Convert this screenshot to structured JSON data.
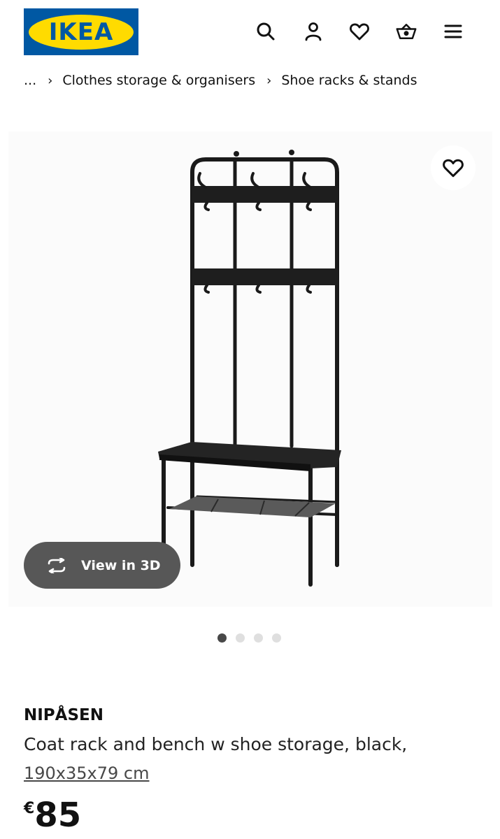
{
  "header": {
    "logo_text": "IKEA",
    "icons": [
      "search-icon",
      "user-icon",
      "heart-icon",
      "basket-icon",
      "menu-icon"
    ]
  },
  "breadcrumb": {
    "items": [
      "...",
      "Clothes storage & organisers",
      "Shoe racks & stands"
    ],
    "separator": "›"
  },
  "gallery": {
    "view3d_label": "View in 3D",
    "dots_total": 4,
    "dots_active": 1
  },
  "product": {
    "name": "NIPÅSEN",
    "description": "Coat rack and bench w shoe storage, black,",
    "dimensions": "190x35x79 cm",
    "currency": "€",
    "price": "85"
  },
  "colors": {
    "ikea_blue": "#0058a3",
    "ikea_yellow": "#ffdb00",
    "view3d_bg": "#575757"
  }
}
